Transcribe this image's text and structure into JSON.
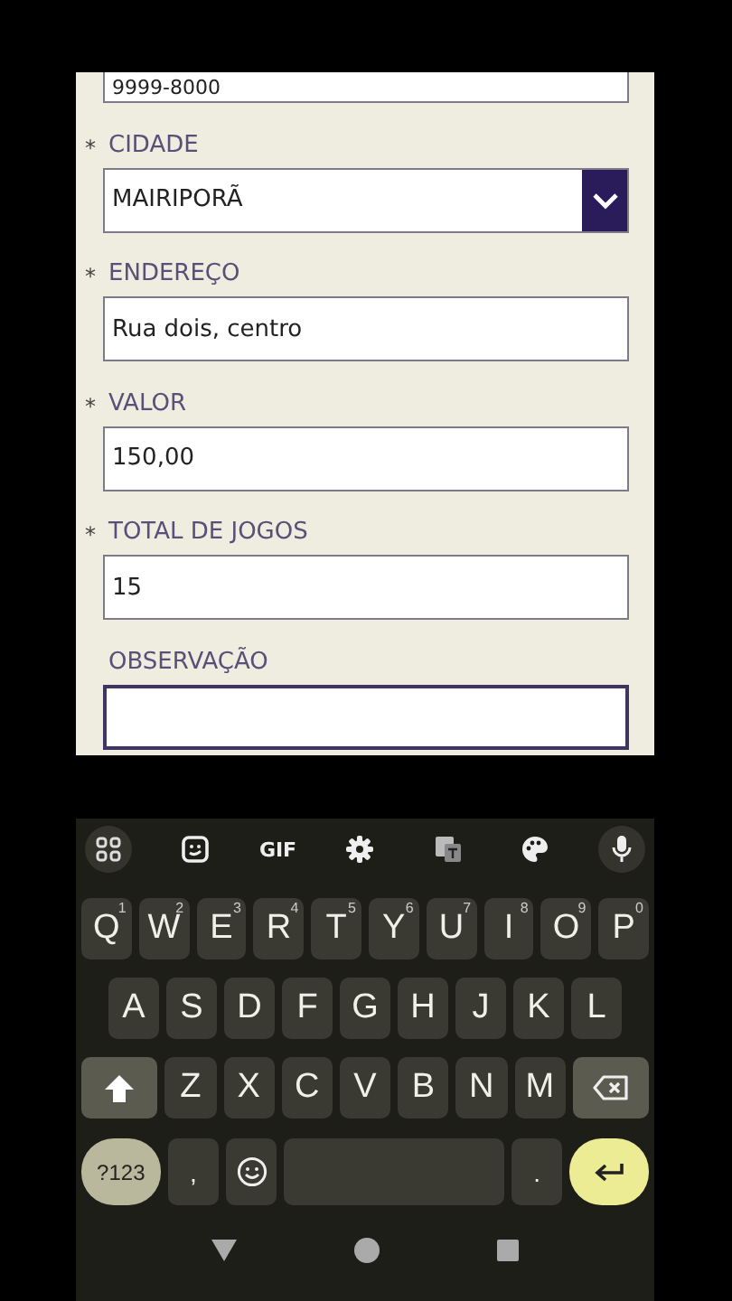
{
  "top_field": {
    "value": "9999-8000"
  },
  "fields": [
    {
      "label": "CIDADE",
      "required": true,
      "kind": "dropdown",
      "value": "MAIRIPORÃ",
      "focused": false
    },
    {
      "label": "ENDEREÇO",
      "required": true,
      "kind": "text",
      "value": "Rua dois, centro",
      "focused": false
    },
    {
      "label": "VALOR",
      "required": true,
      "kind": "text",
      "value": "150,00",
      "focused": false
    },
    {
      "label": "TOTAL DE JOGOS",
      "required": true,
      "kind": "text",
      "value": "15",
      "focused": false
    },
    {
      "label": "OBSERVAÇÃO",
      "required": false,
      "kind": "text",
      "focused": true
    }
  ],
  "required_mark": "*",
  "keyboard": {
    "gif": "GIF",
    "rows": [
      [
        {
          "label": "Q",
          "hint": "1"
        },
        {
          "label": "W",
          "hint": "2"
        },
        {
          "label": "E",
          "hint": "3"
        },
        {
          "label": "R",
          "hint": "4"
        },
        {
          "label": "T",
          "hint": "5"
        },
        {
          "label": "Y",
          "hint": "6"
        },
        {
          "label": "U",
          "hint": "7"
        },
        {
          "label": "I",
          "hint": "8"
        },
        {
          "label": "O",
          "hint": "9"
        },
        {
          "label": "P",
          "hint": "0"
        }
      ],
      [
        {
          "label": "A"
        },
        {
          "label": "S"
        },
        {
          "label": "D"
        },
        {
          "label": "F"
        },
        {
          "label": "G"
        },
        {
          "label": "H"
        },
        {
          "label": "J"
        },
        {
          "label": "K"
        },
        {
          "label": "L"
        }
      ],
      [
        {
          "label": "Z"
        },
        {
          "label": "X"
        },
        {
          "label": "C"
        },
        {
          "label": "V"
        },
        {
          "label": "B"
        },
        {
          "label": "N"
        },
        {
          "label": "M"
        }
      ]
    ],
    "symbols": "?123",
    "comma": ",",
    "period": "."
  }
}
